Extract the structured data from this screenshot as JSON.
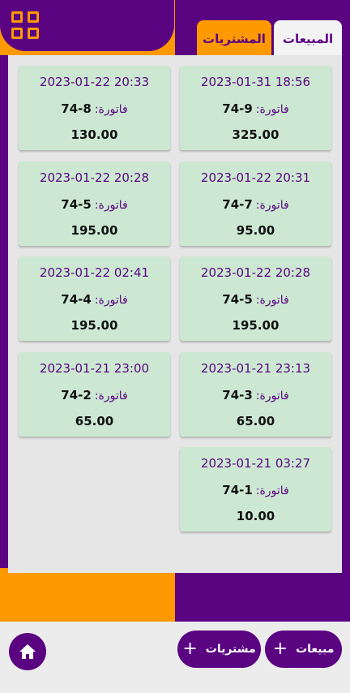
{
  "tabs": {
    "sales": "المبيعات",
    "purchases": "المشتريات"
  },
  "invoice_label": "فاتورة:",
  "invoices": [
    {
      "date": "2023-01-31 18:56",
      "number": "74-9",
      "amount": "325.00"
    },
    {
      "date": "2023-01-22 20:33",
      "number": "74-8",
      "amount": "130.00"
    },
    {
      "date": "2023-01-22 20:31",
      "number": "74-7",
      "amount": "95.00"
    },
    {
      "date": "2023-01-22 20:28",
      "number": "74-5",
      "amount": "195.00"
    },
    {
      "date": "2023-01-22 20:28",
      "number": "74-5",
      "amount": "195.00"
    },
    {
      "date": "2023-01-22 02:41",
      "number": "74-4",
      "amount": "195.00"
    },
    {
      "date": "2023-01-21 23:13",
      "number": "74-3",
      "amount": "65.00"
    },
    {
      "date": "2023-01-21 23:00",
      "number": "74-2",
      "amount": "65.00"
    },
    {
      "date": "2023-01-21 03:27",
      "number": "74-1",
      "amount": "10.00"
    }
  ],
  "actions": {
    "sales_label": "مبيعات",
    "purchases_label": "مشتريات",
    "plus": "+"
  },
  "icons": {
    "menu": "grid-icon",
    "home": "home-icon"
  },
  "colors": {
    "purple": "#5a0482",
    "orange": "#ff9900",
    "card": "#cce8d2",
    "panel": "#e6e6e6"
  }
}
